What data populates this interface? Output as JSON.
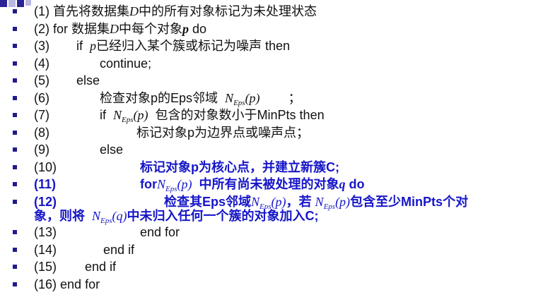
{
  "colors": {
    "bullet": "#1f1b8f",
    "text": "#111111",
    "highlight": "#1616c8",
    "corner_primary": "#2a2396",
    "corner_secondary": "#b9b7e2"
  },
  "lines": [
    {
      "pre": "(1) 首先将数据集",
      "var": "D",
      "post": "中的所有对象标记为未处理状态"
    },
    {
      "pre": "(2) for 数据集",
      "var": "D",
      "mid": "中每个对象",
      "var2": "p",
      "post": " do"
    },
    {
      "num": "(3)",
      "kw": "if",
      "var": "p",
      "post": "已经归入某个簇或标记为噪声 then"
    },
    {
      "num": "(4)",
      "text": "continue;"
    },
    {
      "num": "(5)",
      "text": "else"
    },
    {
      "num": "(6)",
      "pre": "检查对象p的Eps邻域",
      "math": "N",
      "sub": "Eps",
      "arg": "(p)",
      "post": "；"
    },
    {
      "num": "(7)",
      "kw": "if",
      "math": "N",
      "sub": "Eps",
      "arg": "(p)",
      "post": "包含的对象数小于MinPts then"
    },
    {
      "num": "(8)",
      "text": "标记对象p为边界点或噪声点；"
    },
    {
      "num": "(9)",
      "text": "else"
    },
    {
      "num": "(10)",
      "text": "标记对象p为核心点，并建立新簇C;"
    },
    {
      "num": "(11)",
      "kw": "for",
      "math": "N",
      "sub": "Eps",
      "arg": "(p)",
      "post": "中所有尚未被处理的对象",
      "var": "q",
      "tail": " do"
    },
    {
      "num": "(12)",
      "pre": "检查其Eps邻域",
      "math": "N",
      "sub": "Eps",
      "arg": "(p)",
      "mid": "，若",
      "math2": "N",
      "sub2": "Eps",
      "arg2": "(p)",
      "post": "包含至少MinPts个对"
    },
    {
      "cont_pre": "象，则将",
      "math": "N",
      "sub": "Eps",
      "arg": "(q)",
      "post": "中未归入任何一个簇的对象加入C;"
    },
    {
      "num": "(13)",
      "text": "end for"
    },
    {
      "num": "(14)",
      "text": "end if"
    },
    {
      "num": "(15)",
      "text": "end if"
    },
    {
      "num": "(16)",
      "text": "end for"
    }
  ]
}
